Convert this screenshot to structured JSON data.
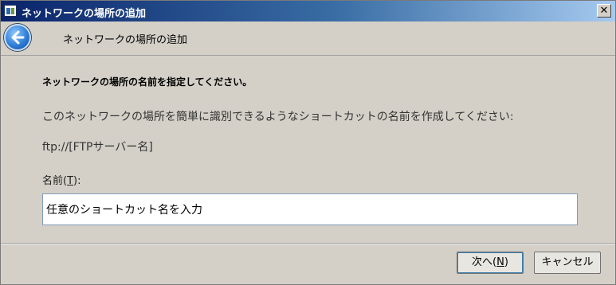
{
  "window": {
    "title": "ネットワークの場所の追加",
    "close_label": "✕"
  },
  "header": {
    "title": "ネットワークの場所の追加"
  },
  "main": {
    "heading": "ネットワークの場所の名前を指定してください。",
    "description": "このネットワークの場所を簡単に識別できるようなショートカットの名前を作成してください:",
    "ftp_text": "ftp://[FTPサーバー名]",
    "name_label_prefix": "名前(",
    "name_label_accel": "T",
    "name_label_suffix": "):",
    "name_value": "任意のショートカット名を入力"
  },
  "buttons": {
    "next_prefix": "次へ(",
    "next_accel": "N",
    "next_suffix": ")",
    "cancel": "キャンセル"
  },
  "icons": {
    "back": "back-arrow-icon",
    "title": "network-window-icon"
  },
  "colors": {
    "titlebar_start": "#0a246a",
    "titlebar_end": "#a6caf0",
    "dialog_bg": "#d4d0c8",
    "back_button": "#2f7fd8"
  }
}
